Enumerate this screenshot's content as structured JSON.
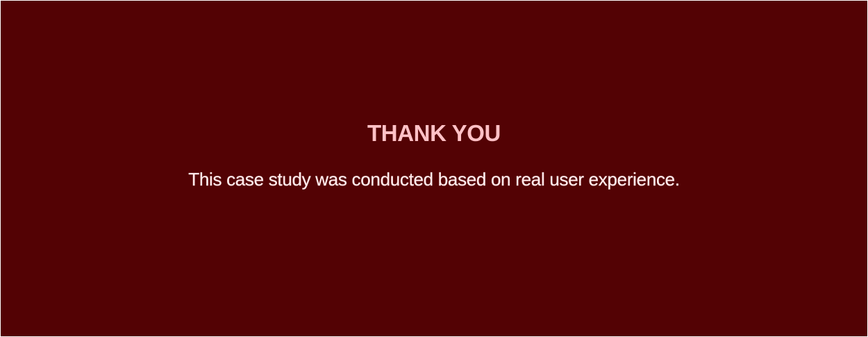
{
  "colors": {
    "background": "#530204",
    "title": "#ffc1c6",
    "subtitle": "#ffe9ea"
  },
  "slide": {
    "title": "THANK YOU",
    "subtitle": "This case study was conducted based on real user experience."
  }
}
